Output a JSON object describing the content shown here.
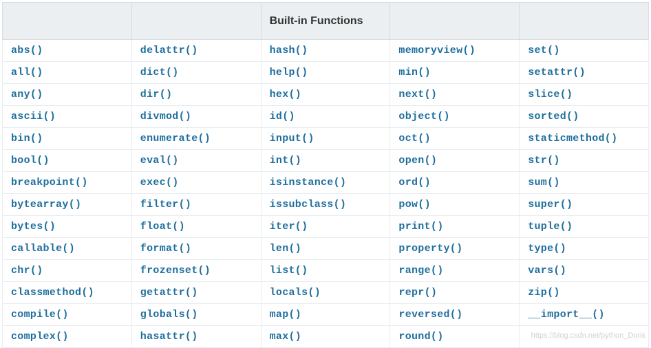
{
  "table": {
    "headers": [
      "",
      "",
      "Built-in Functions",
      "",
      ""
    ],
    "rows": [
      [
        "abs()",
        "delattr()",
        "hash()",
        "memoryview()",
        "set()"
      ],
      [
        "all()",
        "dict()",
        "help()",
        "min()",
        "setattr()"
      ],
      [
        "any()",
        "dir()",
        "hex()",
        "next()",
        "slice()"
      ],
      [
        "ascii()",
        "divmod()",
        "id()",
        "object()",
        "sorted()"
      ],
      [
        "bin()",
        "enumerate()",
        "input()",
        "oct()",
        "staticmethod()"
      ],
      [
        "bool()",
        "eval()",
        "int()",
        "open()",
        "str()"
      ],
      [
        "breakpoint()",
        "exec()",
        "isinstance()",
        "ord()",
        "sum()"
      ],
      [
        "bytearray()",
        "filter()",
        "issubclass()",
        "pow()",
        "super()"
      ],
      [
        "bytes()",
        "float()",
        "iter()",
        "print()",
        "tuple()"
      ],
      [
        "callable()",
        "format()",
        "len()",
        "property()",
        "type()"
      ],
      [
        "chr()",
        "frozenset()",
        "list()",
        "range()",
        "vars()"
      ],
      [
        "classmethod()",
        "getattr()",
        "locals()",
        "repr()",
        "zip()"
      ],
      [
        "compile()",
        "globals()",
        "map()",
        "reversed()",
        "__import__()"
      ],
      [
        "complex()",
        "hasattr()",
        "max()",
        "round()",
        ""
      ]
    ]
  },
  "watermark": "https://blog.csdn.net/python_Doris"
}
